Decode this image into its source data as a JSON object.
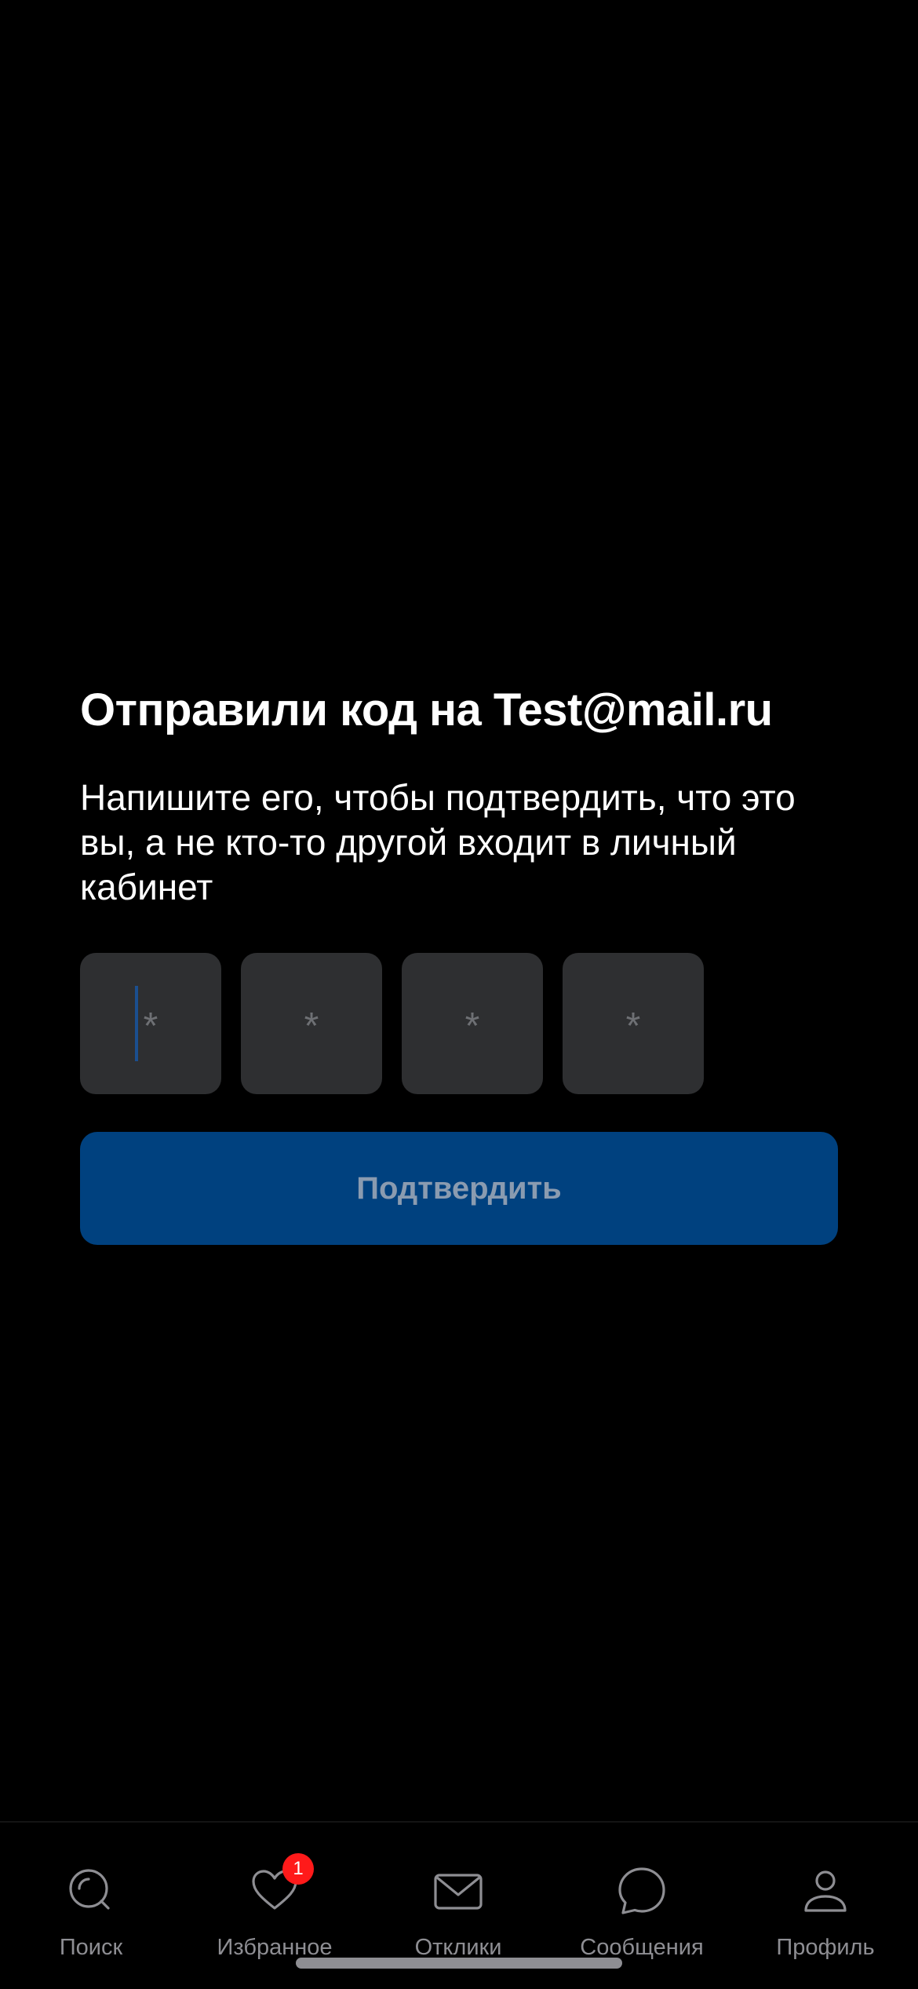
{
  "verification": {
    "title": "Отправили код на Test@mail.ru",
    "subtitle": "Напишите его, чтобы подтвердить, что это вы, а не кто-то другой входит в личный кабинет",
    "code_cells": [
      {
        "value": "",
        "placeholder": "*",
        "focused": true
      },
      {
        "value": "",
        "placeholder": "*",
        "focused": false
      },
      {
        "value": "",
        "placeholder": "*",
        "focused": false
      },
      {
        "value": "",
        "placeholder": "*",
        "focused": false
      }
    ],
    "confirm_label": "Подтвердить"
  },
  "tabbar": {
    "tabs": [
      {
        "label": "Поиск",
        "icon": "search-icon"
      },
      {
        "label": "Избранное",
        "icon": "heart-icon",
        "badge": "1"
      },
      {
        "label": "Отклики",
        "icon": "envelope-icon"
      },
      {
        "label": "Сообщения",
        "icon": "chat-bubble-icon"
      },
      {
        "label": "Профиль",
        "icon": "person-icon"
      }
    ]
  },
  "colors": {
    "background": "#000000",
    "cell_background": "#2e2f31",
    "button_background": "#00417f",
    "button_text": "#8a9bb0",
    "badge": "#ff1a1a",
    "tab_label": "#8e8e93"
  }
}
